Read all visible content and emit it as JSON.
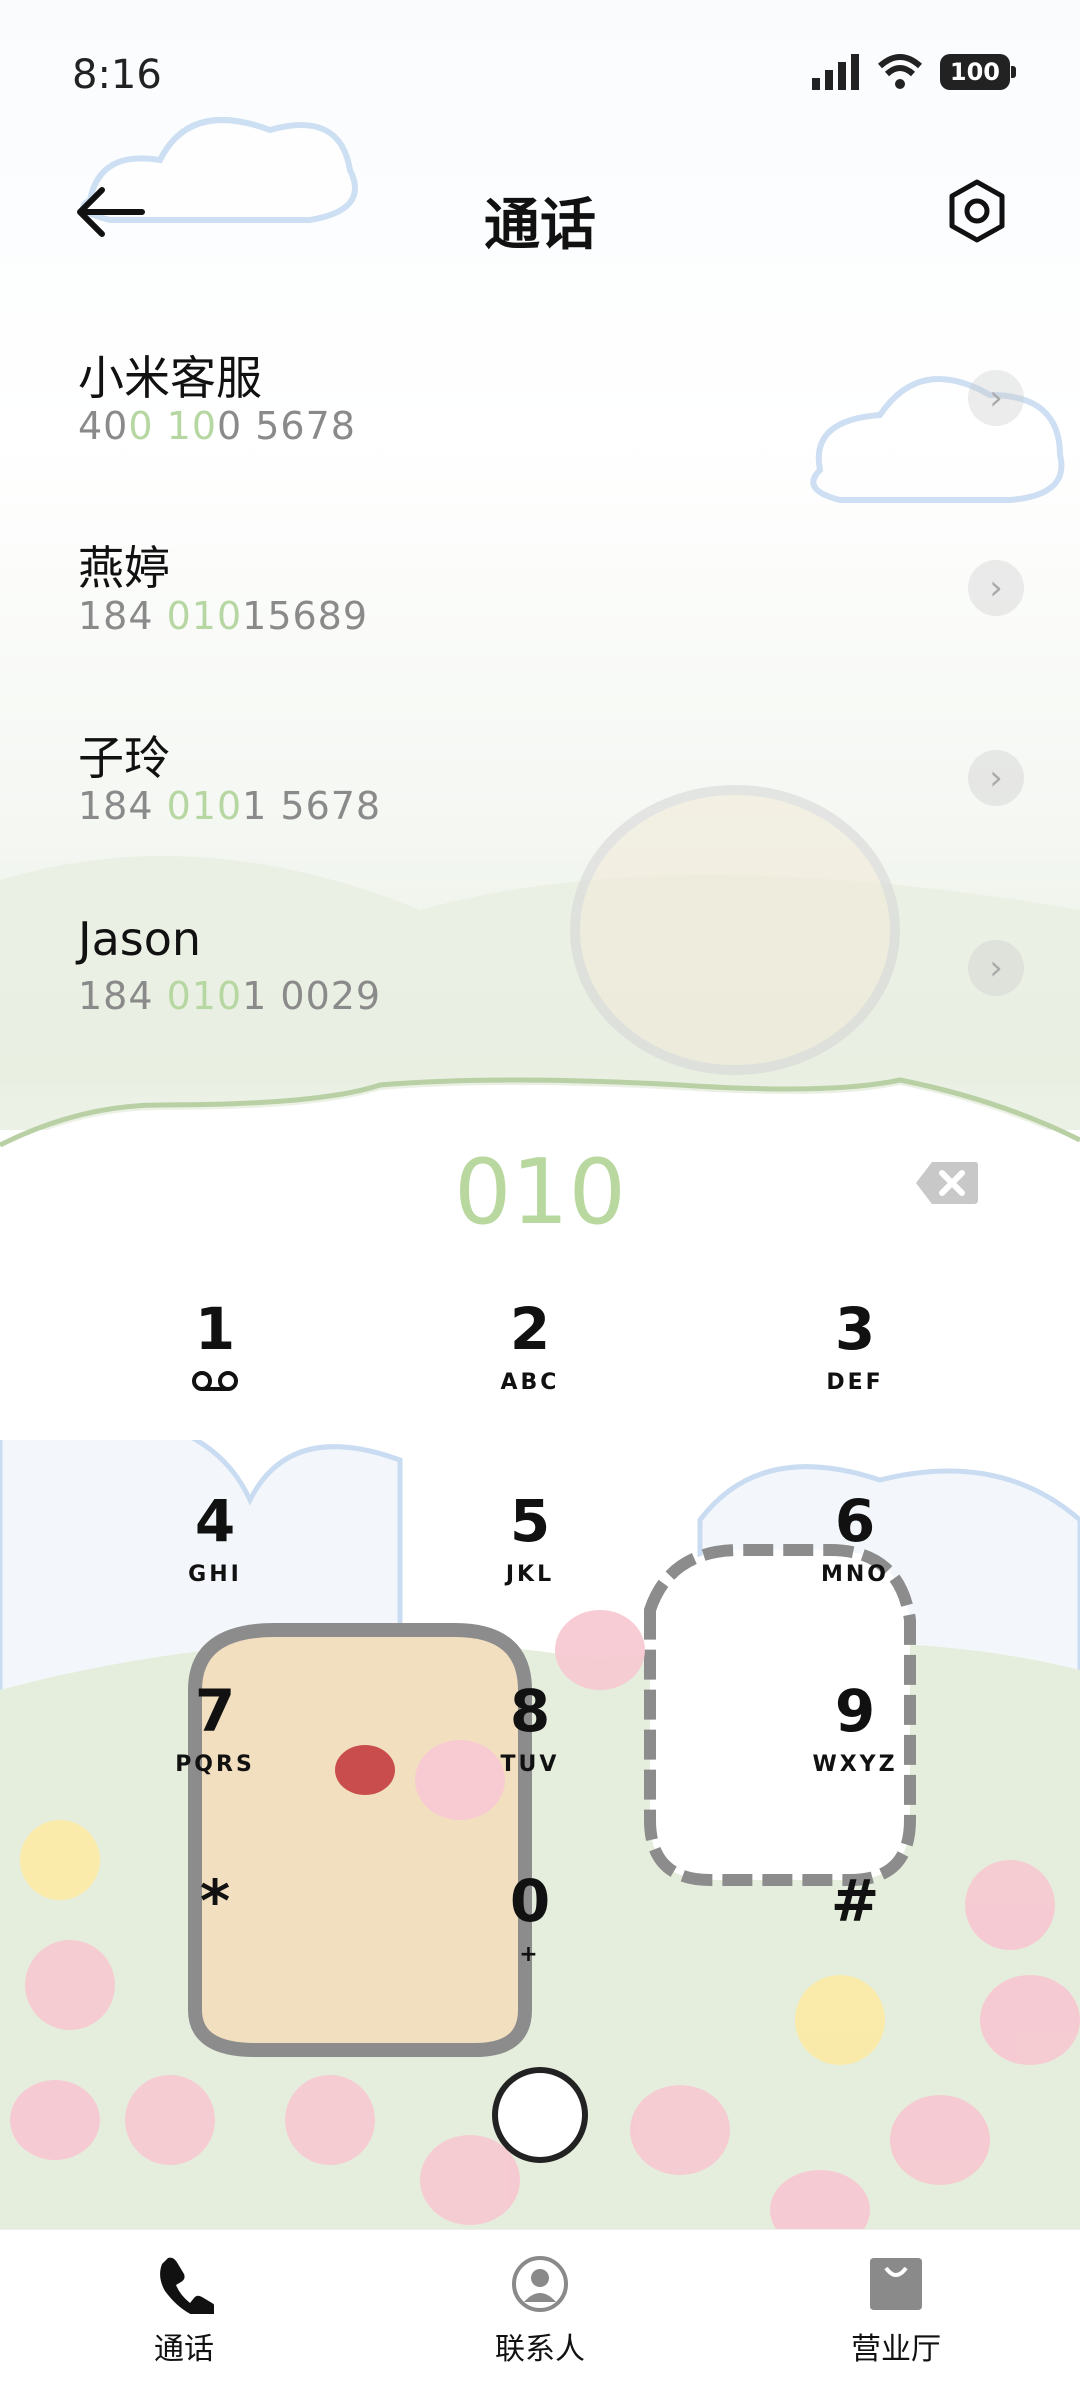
{
  "status": {
    "time": "8:16",
    "battery": "100"
  },
  "header": {
    "title": "通话"
  },
  "contacts": [
    {
      "name": "小米客服",
      "num_parts": [
        "40",
        "0",
        " ",
        "10",
        "0 5678"
      ]
    },
    {
      "name": "燕婷",
      "num_parts": [
        "184 ",
        "010",
        "15689"
      ]
    },
    {
      "name": "子玲",
      "num_parts": [
        "184 ",
        "010",
        "1 5678"
      ]
    },
    {
      "name": "Jason",
      "num_parts": [
        "184 ",
        "010",
        "1 0029"
      ]
    }
  ],
  "dialer": {
    "input": "010",
    "keys": [
      {
        "digit": "1",
        "letters": ""
      },
      {
        "digit": "2",
        "letters": "ABC"
      },
      {
        "digit": "3",
        "letters": "DEF"
      },
      {
        "digit": "4",
        "letters": "GHI"
      },
      {
        "digit": "5",
        "letters": "JKL"
      },
      {
        "digit": "6",
        "letters": "MNO"
      },
      {
        "digit": "7",
        "letters": "PQRS"
      },
      {
        "digit": "8",
        "letters": "TUV"
      },
      {
        "digit": "9",
        "letters": "WXYZ"
      },
      {
        "digit": "*",
        "letters": ""
      },
      {
        "digit": "0",
        "letters": "+"
      },
      {
        "digit": "#",
        "letters": ""
      }
    ]
  },
  "tabs": [
    {
      "label": "通话",
      "icon": "phone-icon",
      "active": true
    },
    {
      "label": "联系人",
      "icon": "person-icon",
      "active": false
    },
    {
      "label": "营业厅",
      "icon": "bag-icon",
      "active": false
    }
  ],
  "colors": {
    "highlight": "#b9d8a0",
    "grass": "#cfe1b9",
    "cloud": "#c9dcf2"
  }
}
